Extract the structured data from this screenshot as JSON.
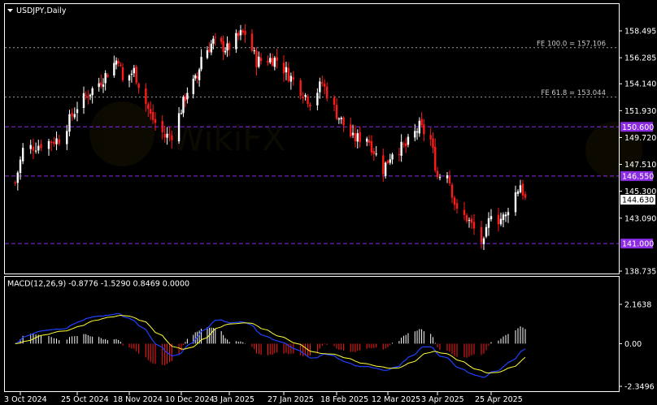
{
  "header": {
    "symbol_label": "USDJPY,Daily"
  },
  "colors": {
    "background": "#000000",
    "bull_candle": "#ffffff",
    "bear_candle": "#ff1a1a",
    "grid_border": "#ffffff",
    "fe_level": "#9a9a9a",
    "key_level": "#8b2be2",
    "histogram_pos": "#ffffff",
    "histogram_neg": "#ff1a1a",
    "macd_line": "#1e40ff",
    "signal_line": "#ffff33"
  },
  "price_panel": {
    "y_ticks": [
      "158.495",
      "156.285",
      "154.140",
      "151.930",
      "149.720",
      "147.510",
      "145.300",
      "143.090",
      "138.735"
    ],
    "fe_levels": [
      {
        "label": "FE 100.0 = 157.106",
        "value": 157.106
      },
      {
        "label": "FE 61.8 = 153.044",
        "value": 153.044
      }
    ],
    "key_levels": [
      {
        "label": "150.600",
        "value": 150.6
      },
      {
        "label": "146.550",
        "value": 146.55
      },
      {
        "label": "141.000",
        "value": 141.0
      }
    ],
    "current_price": "144.630"
  },
  "macd_panel": {
    "title": "MACD(12,26,9) -0.8776 -1.5290 0.8469 0.0000",
    "y_ticks": [
      "2.1638",
      "0.00",
      "-2.3496"
    ]
  },
  "x_axis": {
    "labels": [
      "3 Oct 2024",
      "25 Oct 2024",
      "18 Nov 2024",
      "10 Dec 2024",
      "3 Jan 2025",
      "27 Jan 2025",
      "18 Feb 2025",
      "12 Mar 2025",
      "3 Apr 2025",
      "25 Apr 2025"
    ]
  },
  "chart_data": {
    "type": "candlestick",
    "instrument": "USDJPY",
    "timeframe": "Daily",
    "ylim": [
      138.735,
      160.2
    ],
    "close_path": [
      {
        "date": "2024-10-01",
        "close": 146.0
      },
      {
        "date": "2024-10-04",
        "close": 148.7
      },
      {
        "date": "2024-10-11",
        "close": 149.2
      },
      {
        "date": "2024-10-18",
        "close": 149.6
      },
      {
        "date": "2024-10-25",
        "close": 152.3
      },
      {
        "date": "2024-10-30",
        "close": 153.3
      },
      {
        "date": "2024-11-06",
        "close": 154.6
      },
      {
        "date": "2024-11-13",
        "close": 156.3
      },
      {
        "date": "2024-11-15",
        "close": 154.3
      },
      {
        "date": "2024-11-20",
        "close": 155.2
      },
      {
        "date": "2024-11-27",
        "close": 151.5
      },
      {
        "date": "2024-12-03",
        "close": 149.8
      },
      {
        "date": "2024-12-06",
        "close": 150.0
      },
      {
        "date": "2024-12-13",
        "close": 153.6
      },
      {
        "date": "2024-12-18",
        "close": 154.6
      },
      {
        "date": "2024-12-20",
        "close": 156.4
      },
      {
        "date": "2024-12-26",
        "close": 157.6
      },
      {
        "date": "2025-01-02",
        "close": 157.0
      },
      {
        "date": "2025-01-08",
        "close": 158.2
      },
      {
        "date": "2025-01-10",
        "close": 158.3
      },
      {
        "date": "2025-01-15",
        "close": 156.0
      },
      {
        "date": "2025-01-22",
        "close": 156.2
      },
      {
        "date": "2025-01-24",
        "close": 156.1
      },
      {
        "date": "2025-01-31",
        "close": 154.4
      },
      {
        "date": "2025-02-07",
        "close": 152.7
      },
      {
        "date": "2025-02-12",
        "close": 154.2
      },
      {
        "date": "2025-02-18",
        "close": 151.7
      },
      {
        "date": "2025-02-25",
        "close": 149.6
      },
      {
        "date": "2025-03-03",
        "close": 149.8
      },
      {
        "date": "2025-03-10",
        "close": 147.1
      },
      {
        "date": "2025-03-14",
        "close": 148.6
      },
      {
        "date": "2025-03-20",
        "close": 149.0
      },
      {
        "date": "2025-03-26",
        "close": 150.6
      },
      {
        "date": "2025-03-31",
        "close": 149.5
      },
      {
        "date": "2025-04-03",
        "close": 146.5
      },
      {
        "date": "2025-04-07",
        "close": 147.0
      },
      {
        "date": "2025-04-11",
        "close": 143.5
      },
      {
        "date": "2025-04-15",
        "close": 143.1
      },
      {
        "date": "2025-04-22",
        "close": 140.9
      },
      {
        "date": "2025-04-25",
        "close": 143.7
      },
      {
        "date": "2025-04-28",
        "close": 143.0
      },
      {
        "date": "2025-05-01",
        "close": 143.2
      },
      {
        "date": "2025-05-02",
        "close": 144.0
      },
      {
        "date": "2025-05-07",
        "close": 145.9
      },
      {
        "date": "2025-05-09",
        "close": 144.6
      }
    ],
    "macd": {
      "title": "MACD(12,26,9)",
      "values": {
        "main": -0.8776,
        "signal": -1.529,
        "histogram": 0.8469,
        "zero": 0.0
      },
      "ylim": [
        -2.3496,
        2.1638
      ]
    }
  }
}
